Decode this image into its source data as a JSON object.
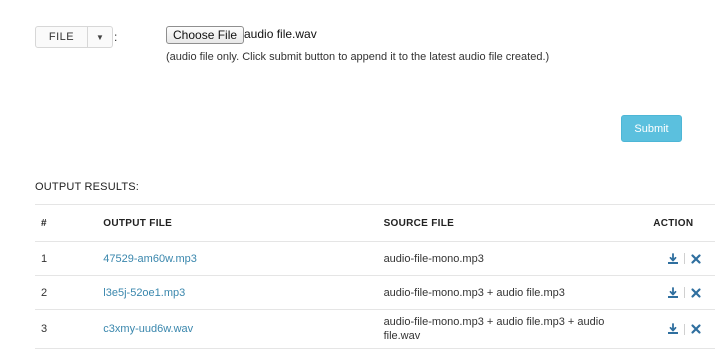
{
  "form": {
    "file_type": "FILE",
    "colon": ":",
    "choose_label": "Choose File",
    "chosen_file": "audio file.wav",
    "hint": "(audio file only. Click submit button to append it to the latest audio file created.)",
    "submit_label": "Submit"
  },
  "results": {
    "heading": "OUTPUT RESULTS:",
    "columns": [
      "#",
      "OUTPUT FILE",
      "SOURCE FILE",
      "ACTION"
    ],
    "rows": [
      {
        "num": "1",
        "output": "47529-am60w.mp3",
        "source": "audio-file-mono.mp3"
      },
      {
        "num": "2",
        "output": "l3e5j-52oe1.mp3",
        "source": "audio-file-mono.mp3 + audio file.mp3"
      },
      {
        "num": "3",
        "output": "c3xmy-uud6w.wav",
        "source": "audio-file-mono.mp3 + audio file.mp3 + audio file.wav"
      }
    ]
  },
  "colors": {
    "accent": "#5bc0de",
    "link": "#3a87ad",
    "icon": "#2f6f9f"
  },
  "icons": {
    "download": "download-icon",
    "delete": "delete-icon",
    "caret": "caret-down-icon"
  }
}
